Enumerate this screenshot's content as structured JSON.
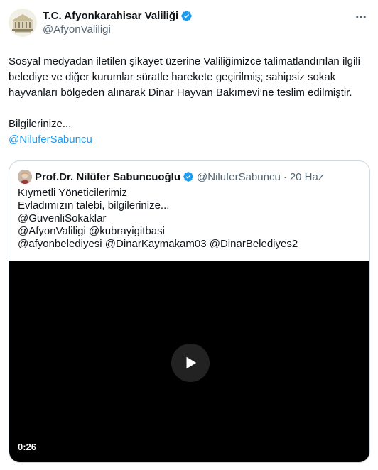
{
  "tweet": {
    "author_name": "T.C. Afyonkarahisar Valiliği",
    "author_handle": "@AfyonValiligi",
    "body": "Sosyal medyadan iletilen şikayet üzerine Valiliğimizce talimatlandırılan ilgili belediye ve diğer kurumlar süratle harekete geçirilmiş; sahipsiz sokak hayvanları bölgeden alınarak Dinar Hayvan Bakımevi’ne teslim edilmiştir.",
    "signoff": "Bilgilerinize...",
    "mention": "@NiluferSabuncu"
  },
  "quote": {
    "author_name": "Prof.Dr. Nilüfer Sabuncuoğlu",
    "author_handle": "@NiluferSabuncu",
    "separator": "·",
    "date": "20 Haz",
    "lines": [
      "Kıymetli Yöneticilerimiz",
      "Evladımızın talebi, bilgilerinize...",
      "@GuvenliSokaklar",
      "@AfyonValiligi @kubrayigitbasi",
      "@afyonbelediyesi @DinarKaymakam03 @DinarBelediyes2"
    ],
    "video_duration": "0:26"
  },
  "colors": {
    "link": "#1d9bf0",
    "verified": "#1d9bf0",
    "secondary_text": "#536471",
    "video_bg": "#000000"
  },
  "icons": [
    "verified-badge-icon",
    "more-options-icon",
    "play-icon"
  ]
}
